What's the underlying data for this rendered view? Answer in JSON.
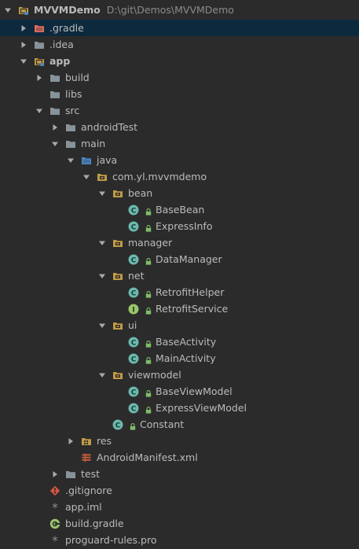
{
  "project": {
    "name": "MVVMDemo",
    "path": "D:\\git\\Demos\\MVVMDemo"
  },
  "tree": [
    {
      "label": "MVVMDemo",
      "depth": 0,
      "expanded": true,
      "icon": "module-folder-icon",
      "bold": true
    },
    {
      "label": ".gradle",
      "depth": 1,
      "expanded": false,
      "icon": "folder-excluded-icon",
      "selected": true
    },
    {
      "label": ".idea",
      "depth": 1,
      "expanded": false,
      "icon": "folder-icon"
    },
    {
      "label": "app",
      "depth": 1,
      "expanded": true,
      "icon": "module-folder-icon",
      "bold": true
    },
    {
      "label": "build",
      "depth": 2,
      "expanded": false,
      "icon": "folder-icon"
    },
    {
      "label": "libs",
      "depth": 2,
      "icon": "folder-icon"
    },
    {
      "label": "src",
      "depth": 2,
      "expanded": true,
      "icon": "folder-icon"
    },
    {
      "label": "androidTest",
      "depth": 3,
      "expanded": false,
      "icon": "folder-icon"
    },
    {
      "label": "main",
      "depth": 3,
      "expanded": true,
      "icon": "folder-icon"
    },
    {
      "label": "java",
      "depth": 4,
      "expanded": true,
      "icon": "source-folder-icon"
    },
    {
      "label": "com.yl.mvvmdemo",
      "depth": 5,
      "expanded": true,
      "icon": "package-icon"
    },
    {
      "label": "bean",
      "depth": 6,
      "expanded": true,
      "icon": "package-icon"
    },
    {
      "label": "BaseBean",
      "depth": 7,
      "icon": "class-icon",
      "lock": true
    },
    {
      "label": "ExpressInfo",
      "depth": 7,
      "icon": "class-icon",
      "lock": true
    },
    {
      "label": "manager",
      "depth": 6,
      "expanded": true,
      "icon": "package-icon"
    },
    {
      "label": "DataManager",
      "depth": 7,
      "icon": "class-icon",
      "lock": true
    },
    {
      "label": "net",
      "depth": 6,
      "expanded": true,
      "icon": "package-icon"
    },
    {
      "label": "RetrofitHelper",
      "depth": 7,
      "icon": "class-icon",
      "lock": true
    },
    {
      "label": "RetrofitService",
      "depth": 7,
      "icon": "interface-icon",
      "lock": true
    },
    {
      "label": "ui",
      "depth": 6,
      "expanded": true,
      "icon": "package-icon"
    },
    {
      "label": "BaseActivity",
      "depth": 7,
      "icon": "class-icon",
      "lock": true
    },
    {
      "label": "MainActivity",
      "depth": 7,
      "icon": "class-icon",
      "lock": true
    },
    {
      "label": "viewmodel",
      "depth": 6,
      "expanded": true,
      "icon": "package-icon"
    },
    {
      "label": "BaseViewModel",
      "depth": 7,
      "icon": "class-icon",
      "lock": true
    },
    {
      "label": "ExpressViewModel",
      "depth": 7,
      "icon": "class-icon",
      "lock": true
    },
    {
      "label": "Constant",
      "depth": 6,
      "icon": "class-icon",
      "lock": true
    },
    {
      "label": "res",
      "depth": 4,
      "expanded": false,
      "icon": "resource-folder-icon"
    },
    {
      "label": "AndroidManifest.xml",
      "depth": 4,
      "icon": "manifest-icon"
    },
    {
      "label": "test",
      "depth": 3,
      "expanded": false,
      "icon": "folder-icon"
    },
    {
      "label": ".gitignore",
      "depth": 2,
      "icon": "git-icon"
    },
    {
      "label": "app.iml",
      "depth": 2,
      "icon": "iml-icon"
    },
    {
      "label": "build.gradle",
      "depth": 2,
      "icon": "gradle-icon"
    },
    {
      "label": "proguard-rules.pro",
      "depth": 2,
      "icon": "text-file-icon"
    }
  ]
}
